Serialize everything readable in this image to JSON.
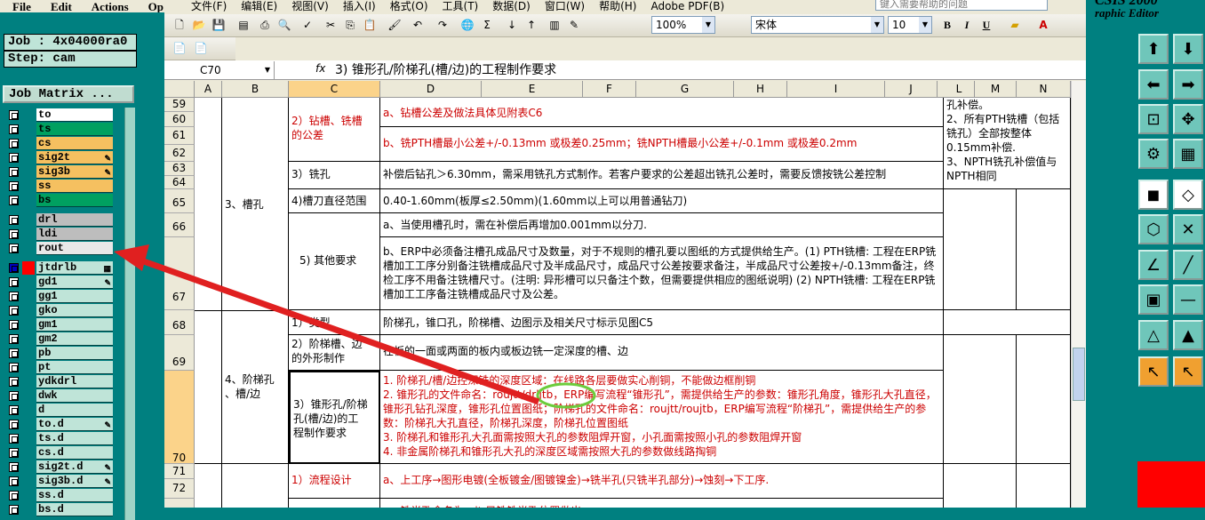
{
  "cam": {
    "menu": [
      "File",
      "Edit",
      "Actions",
      "Op"
    ],
    "job_label": "Job : 4x04000ra0",
    "step_label": "Step: cam",
    "job_matrix_button": "Job Matrix ...",
    "title_partial": "CSIS 2000",
    "subtitle": "raphic Editor",
    "layers_group1": [
      {
        "name": "to",
        "color": "#ffffff",
        "tag": ""
      },
      {
        "name": "ts",
        "color": "#00a060",
        "tag": ""
      },
      {
        "name": "cs",
        "color": "#f5c060",
        "tag": ""
      },
      {
        "name": "sig2t",
        "color": "#f5c060",
        "tag": "✎"
      },
      {
        "name": "sig3b",
        "color": "#f5c060",
        "tag": "✎"
      },
      {
        "name": "ss",
        "color": "#f5c060",
        "tag": ""
      },
      {
        "name": "bs",
        "color": "#00a060",
        "tag": ""
      }
    ],
    "layers_group2": [
      {
        "name": "drl",
        "color": "#bdbdbd",
        "tag": ""
      },
      {
        "name": "ldi",
        "color": "#bdbdbd",
        "tag": ""
      },
      {
        "name": "rout",
        "color": "#e8e8e8",
        "tag": ""
      }
    ],
    "layers_group3": [
      {
        "name": "jtdrlb",
        "color": "#bfe4d8",
        "tag": "▦"
      },
      {
        "name": "gd1",
        "color": "#bfe4d8",
        "tag": "✎"
      },
      {
        "name": "gg1",
        "color": "#bfe4d8",
        "tag": ""
      },
      {
        "name": "gko",
        "color": "#bfe4d8",
        "tag": ""
      },
      {
        "name": "gm1",
        "color": "#bfe4d8",
        "tag": ""
      },
      {
        "name": "gm2",
        "color": "#bfe4d8",
        "tag": ""
      },
      {
        "name": "pb",
        "color": "#bfe4d8",
        "tag": ""
      },
      {
        "name": "pt",
        "color": "#bfe4d8",
        "tag": ""
      },
      {
        "name": "ydkdrl",
        "color": "#bfe4d8",
        "tag": ""
      },
      {
        "name": "dwk",
        "color": "#bfe4d8",
        "tag": ""
      },
      {
        "name": "d",
        "color": "#bfe4d8",
        "tag": ""
      },
      {
        "name": "to.d",
        "color": "#bfe4d8",
        "tag": "✎"
      },
      {
        "name": "ts.d",
        "color": "#bfe4d8",
        "tag": ""
      },
      {
        "name": "cs.d",
        "color": "#bfe4d8",
        "tag": ""
      },
      {
        "name": "sig2t.d",
        "color": "#bfe4d8",
        "tag": "✎"
      },
      {
        "name": "sig3b.d",
        "color": "#bfe4d8",
        "tag": "✎"
      },
      {
        "name": "ss.d",
        "color": "#bfe4d8",
        "tag": ""
      },
      {
        "name": "bs.d",
        "color": "#bfe4d8",
        "tag": ""
      }
    ]
  },
  "excel": {
    "menu": [
      "文件(F)",
      "编辑(E)",
      "视图(V)",
      "插入(I)",
      "格式(O)",
      "工具(T)",
      "数据(D)",
      "窗口(W)",
      "帮助(H)",
      "Adobe PDF(B)"
    ],
    "ask_placeholder": "键入需要帮助的问题",
    "zoom": "100%",
    "font_name": "宋体",
    "font_size": "10",
    "bold": "B",
    "italic": "I",
    "underline": "U",
    "name_box": "C70",
    "fx": "fx",
    "formula": "3) 锥形孔/阶梯孔(槽/边)的工程制作要求",
    "columns": [
      "A",
      "B",
      "C",
      "D",
      "E",
      "F",
      "G",
      "H",
      "I",
      "J",
      "K",
      "L",
      "M",
      "N"
    ],
    "rows": {
      "r59": "59",
      "r60": "60",
      "r61": "61",
      "r62": "62",
      "r63": "63",
      "r64": "64",
      "r65": "65",
      "r66": "66",
      "r67": "67",
      "r68": "68",
      "r69": "69",
      "r70": "70",
      "r71": "71",
      "r72": "72"
    },
    "cells": {
      "b_slot": "3、槽孔",
      "b_step": "4、阶梯孔\n、槽/边",
      "c_tol": "2）钻槽、铣槽\n的公差",
      "c_mill": "3）铣孔",
      "c_knife": "4)槽刀直径范围",
      "c_other": "5) 其他要求",
      "c_type": "1）类型",
      "c_outer": "2）阶梯槽、边\n的外形制作",
      "c_cone": "3）锥形孔/阶梯\n孔(槽/边)的工\n程制作要求",
      "c_flow": "1）流程设计",
      "d60": "a、钻槽公差及做法具体见附表C6",
      "d61": "b、铣PTH槽最小公差+/-0.13mm 或极差0.25mm；铣NPTH槽最小公差+/-0.1mm 或极差0.2mm",
      "d63": "补偿后钻孔＞6.30mm，需采用铣孔方式制作。若客户要求的公差超出铣孔公差时，需要反馈按铣公差控制",
      "d65": "0.40-1.60mm(板厚≤2.50mm)(1.60mm以上可以用普通钻刀)",
      "d66": "a、当使用槽孔时，需在补偿后再增加0.001mm以分刀.",
      "d67": "b、ERP中必须备注槽孔成品尺寸及数量，对于不规则的槽孔要以图纸的方式提供给生产。(1) PTH铣槽: 工程在ERP铣槽加工工序分别备注铣槽成品尺寸及半成品尺寸，成品尺寸公差按要求备注，半成品尺寸公差按+/-0.13mm备注，终检工序不用备注铣槽尺寸。(注明: 异形槽可以只备注个数，但需要提供相应的图纸说明) (2) NPTH铣槽: 工程在ERP铣槽加工工序备注铣槽成品尺寸及公差。",
      "d68": "阶梯孔，锥口孔，阶梯槽、边图示及相关尺寸标示见图C5",
      "d69": "在板的一面或两面的板内或板边铣一定深度的槽、边",
      "d70_1": "1. 阶梯孔/槽/边控深铣的深度区域：在线路各层要做实心削铜，不能做边框削铜",
      "d70_2": "2. 锥形孔的文件命名：roujtt/drljtb，ERP编写流程“锥形孔”，需提供给生产的参数：锥形孔角度，锥形孔大孔直径，锥形孔钻孔深度，锥形孔位置图纸；阶梯孔的文件命名：roujtt/roujtb，ERP编写流程“阶梯孔”，需提供给生产的参数：阶梯孔大孔直径，阶梯孔深度，阶梯孔位置图纸",
      "d70_3": "3. 阶梯孔和锥形孔大孔面需按照大孔的参数阻焊开窗，小孔面需按照小孔的参数阻焊开窗",
      "d70_4": "4. 非金属阶梯孔和锥形孔大孔的深度区域需按照大孔的参数做线路掏铜",
      "d71": "a、上工序→图形电镀(全板镀金/图镀镍金)→铣半孔(只铣半孔部分)→蚀刻→下工序.",
      "d72": "a、铣半孔命名为：jt  只铣铣半孔位置做出",
      "l_note": "孔补偿。\n2、所有PTH铣槽（包括铣孔）全部按整体0.15mm补偿.\n3、NPTH铣孔补偿值与NPTH相同"
    },
    "highlight_text": "drljtb"
  },
  "colors": {
    "arrow": "#e02020",
    "highlight": "#6ccc3c"
  }
}
